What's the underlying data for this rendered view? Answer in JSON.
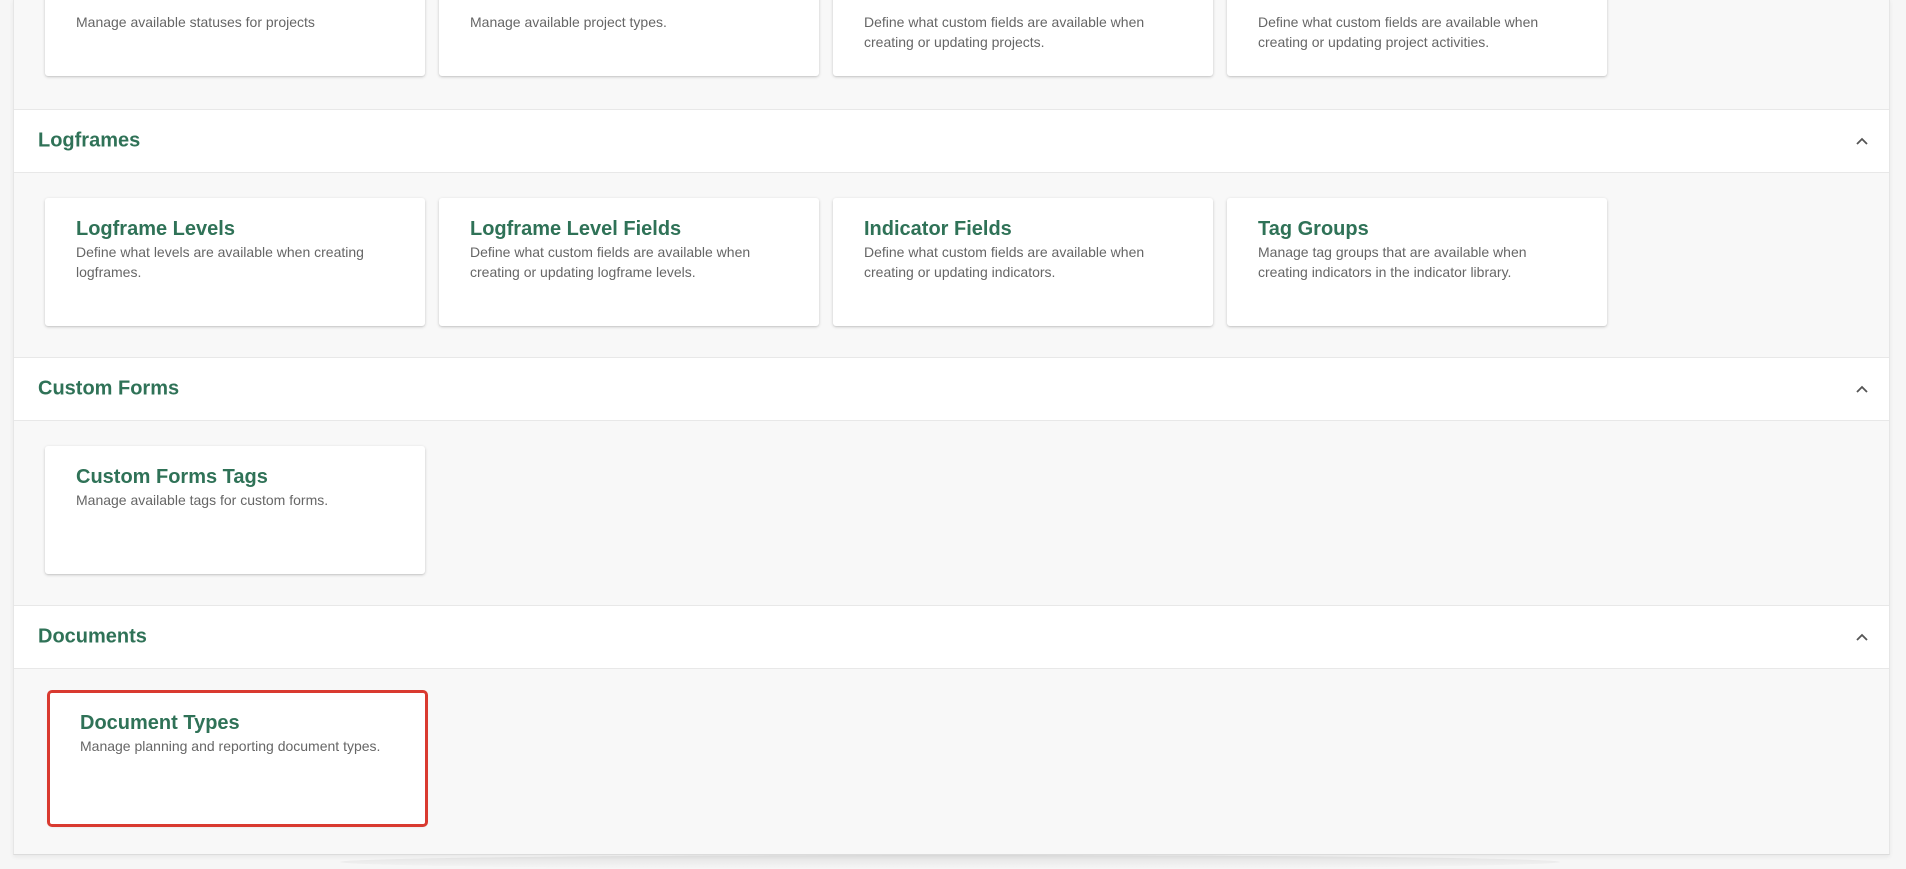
{
  "sections": {
    "projects": {
      "cards": [
        {
          "title": "",
          "desc": "Manage available statuses for projects"
        },
        {
          "title": "",
          "desc": "Manage available project types."
        },
        {
          "title": "",
          "desc": "Define what custom fields are available when creating or updating projects."
        },
        {
          "title": "",
          "desc": "Define what custom fields are available when creating or updating project activities."
        }
      ]
    },
    "logframes": {
      "title": "Logframes",
      "cards": [
        {
          "title": "Logframe Levels",
          "desc": "Define what levels are available when creating logframes."
        },
        {
          "title": "Logframe Level Fields",
          "desc": "Define what custom fields are available when creating or updating logframe levels."
        },
        {
          "title": "Indicator Fields",
          "desc": "Define what custom fields are available when creating or updating indicators."
        },
        {
          "title": "Tag Groups",
          "desc": "Manage tag groups that are available when creating indicators in the indicator library."
        }
      ]
    },
    "custom_forms": {
      "title": "Custom Forms",
      "cards": [
        {
          "title": "Custom Forms Tags",
          "desc": "Manage available tags for custom forms."
        }
      ]
    },
    "documents": {
      "title": "Documents",
      "cards": [
        {
          "title": "Document Types",
          "desc": "Manage planning and reporting document types."
        }
      ]
    }
  },
  "colors": {
    "accent": "#2f7257",
    "highlight": "#d93a30"
  },
  "icons": {
    "collapse": "chevron-up-icon"
  }
}
